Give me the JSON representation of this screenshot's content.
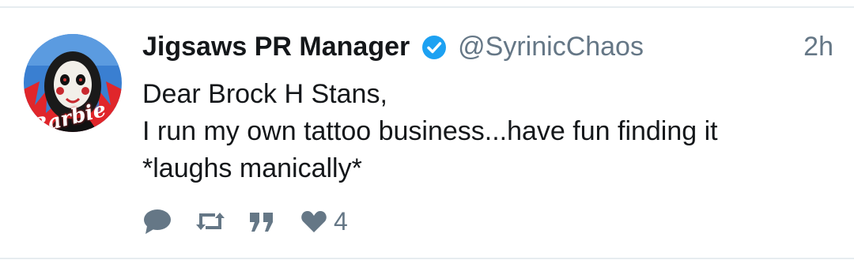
{
  "tweet": {
    "author_name": "Jigsaws PR Manager",
    "verified": true,
    "handle": "@SyrinicChaos",
    "timestamp": "2h",
    "text_lines": [
      "Dear Brock H Stans,",
      "I run my own tattoo business...have fun finding it",
      "*laughs manically*"
    ],
    "avatar": {
      "badge_text": "Barbie"
    },
    "actions": {
      "reply_icon": "reply-bubble-icon",
      "retweet_icon": "retweet-icon",
      "quote_icon": "quote-icon",
      "like_icon": "heart-icon",
      "like_count": "4"
    }
  },
  "colors": {
    "text": "#14171a",
    "secondary": "#657786",
    "verified": "#1da1f2",
    "divider": "#e6ecf0"
  }
}
